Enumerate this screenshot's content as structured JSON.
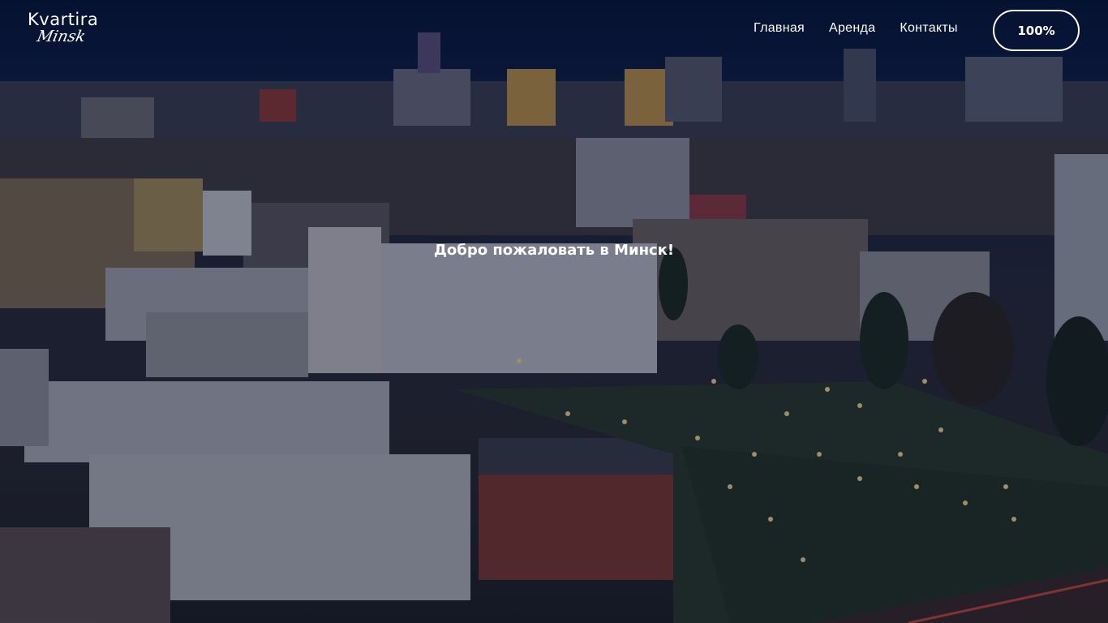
{
  "header": {
    "logo_main": "Kvartira",
    "logo_script": "Minsk",
    "nav": [
      {
        "label": "Главная"
      },
      {
        "label": "Аренда"
      },
      {
        "label": "Контакты"
      }
    ],
    "action_button": "100%"
  },
  "hero": {
    "welcome": "Добро пожаловать в Минск!",
    "background_subject": "city-skyline-night"
  },
  "colors": {
    "sky_top": "#061538",
    "text": "#ffffff",
    "brick_building": "#7a3a34"
  }
}
